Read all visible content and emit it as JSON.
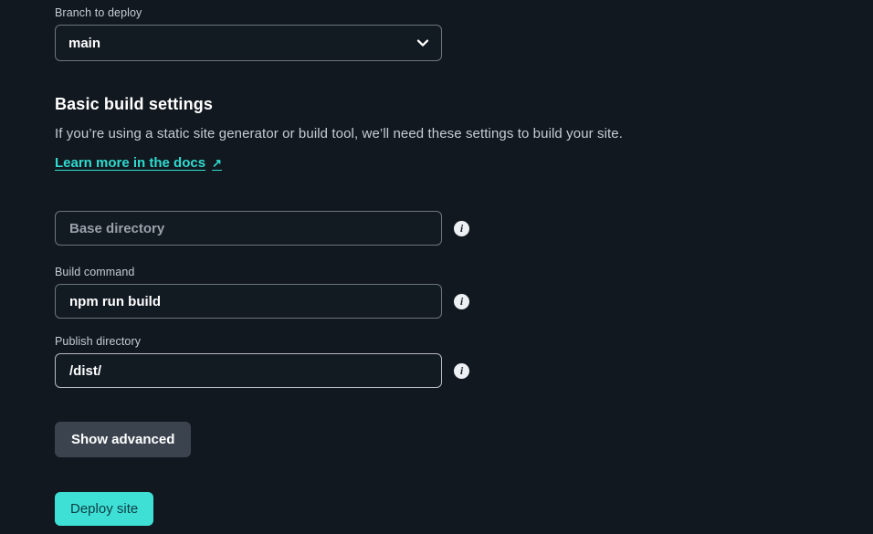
{
  "branch_section": {
    "label": "Branch to deploy",
    "selected_value": "main",
    "chevron_icon": "chevron-down-icon"
  },
  "build_section": {
    "title": "Basic build settings",
    "description": "If you’re using a static site generator or build tool, we’ll need these settings to build your site.",
    "docs_link": {
      "label": "Learn more in the docs",
      "arrow": "↗",
      "icon": "external-link-icon"
    },
    "fields": [
      {
        "label": "",
        "placeholder": "Base directory",
        "value": "",
        "info_icon": "info-icon",
        "focused": false
      },
      {
        "label": "Build command",
        "placeholder": "Build command",
        "value": "npm run build",
        "info_icon": "info-icon",
        "focused": false
      },
      {
        "label": "Publish directory",
        "placeholder": "Publish directory",
        "value": "/dist/",
        "info_icon": "info-icon",
        "focused": true
      }
    ],
    "show_advanced_label": "Show advanced",
    "deploy_label": "Deploy site"
  },
  "colors": {
    "background": "#12181f",
    "accent_teal": "#3ee0d6",
    "link_teal": "#2fdbd0",
    "secondary_button": "#3b434f",
    "input_border": "#6d7580",
    "input_border_focused": "#b6bbc3",
    "label_text": "#c7ccd4",
    "primary_text": "#ffffff",
    "placeholder_text": "#9aa1ab",
    "deploy_text": "#0f3d44"
  }
}
